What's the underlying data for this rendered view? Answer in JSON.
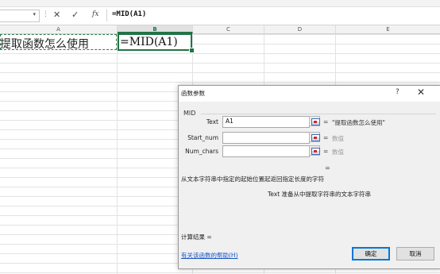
{
  "formula_bar": {
    "name_box_value": "",
    "cancel_icon": "✕",
    "enter_icon": "✓",
    "fx_label": "fx",
    "formula": "=MID(A1)"
  },
  "columns": [
    "A",
    "B",
    "C",
    "D",
    "E"
  ],
  "cells": {
    "A1": "提取函数怎么使用",
    "B1": "=MID(A1)"
  },
  "dialog": {
    "title": "函数参数",
    "help_glyph": "?",
    "close_glyph": "✕",
    "function_name": "MID",
    "args": [
      {
        "label": "Text",
        "value": "A1",
        "equals": "=",
        "result": "\"提取函数怎么使用\""
      },
      {
        "label": "Start_num",
        "value": "",
        "equals": "=",
        "result": "数值"
      },
      {
        "label": "Num_chars",
        "value": "",
        "equals": "=",
        "result": "数值"
      }
    ],
    "overall_equals": "=",
    "description": "从文本字符串中指定的起始位置起返回指定长度的字符",
    "arg_description": "Text  准备从中提取字符串的文本字符串",
    "result_label": "计算结果 =",
    "help_link": "有关该函数的帮助(H)",
    "ok_label": "确定",
    "cancel_label": "取消"
  }
}
